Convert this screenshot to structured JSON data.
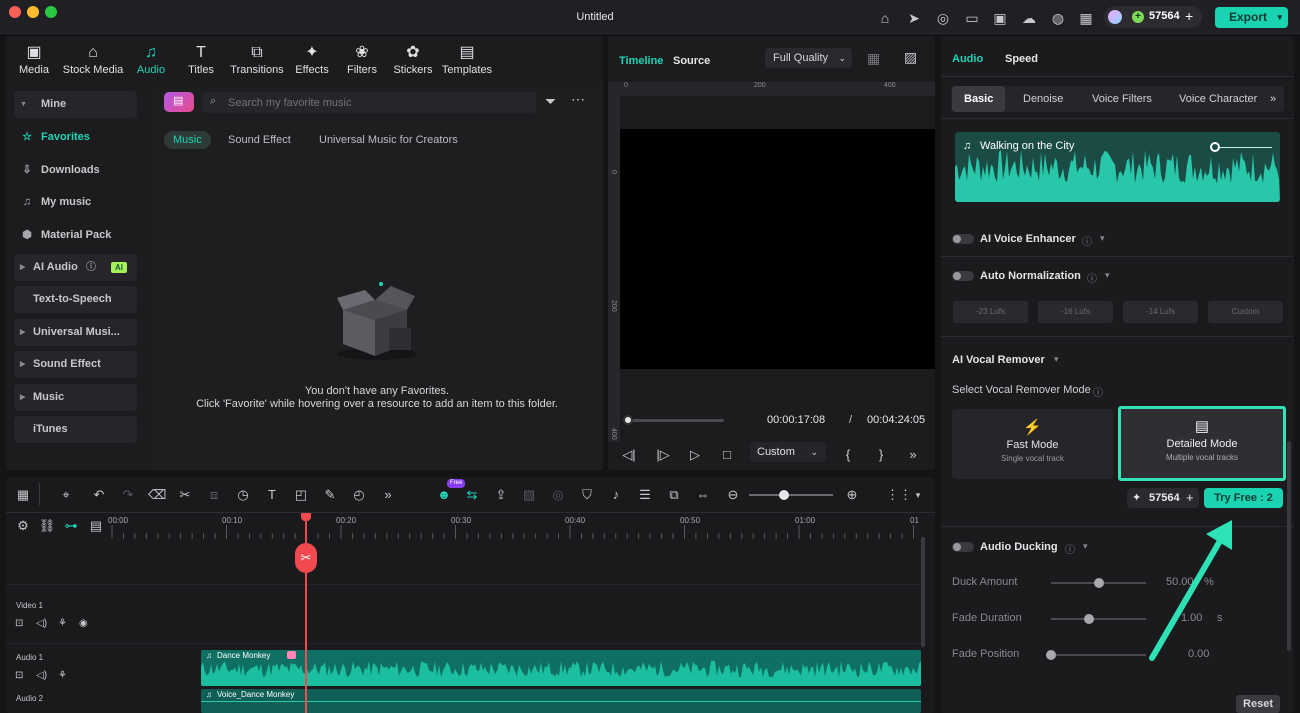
{
  "window": {
    "title": "Untitled"
  },
  "header": {
    "credits": "57564",
    "export_label": "Export"
  },
  "media_toolbar": {
    "items": [
      {
        "label": "Media",
        "icon": "media-icon"
      },
      {
        "label": "Stock Media",
        "icon": "stock-media-icon"
      },
      {
        "label": "Audio",
        "icon": "audio-icon"
      },
      {
        "label": "Titles",
        "icon": "titles-icon"
      },
      {
        "label": "Transitions",
        "icon": "transitions-icon"
      },
      {
        "label": "Effects",
        "icon": "effects-icon"
      },
      {
        "label": "Filters",
        "icon": "filters-icon"
      },
      {
        "label": "Stickers",
        "icon": "stickers-icon"
      },
      {
        "label": "Templates",
        "icon": "templates-icon"
      }
    ]
  },
  "sidebar": {
    "mine": "Mine",
    "favorites": "Favorites",
    "downloads": "Downloads",
    "my_music": "My music",
    "material_pack": "Material Pack",
    "ai_audio": "AI Audio",
    "ai_badge": "AI",
    "text_to_speech": "Text-to-Speech",
    "universal_music": "Universal Musi...",
    "sound_effect": "Sound Effect",
    "music": "Music",
    "itunes": "iTunes"
  },
  "media_content": {
    "search_placeholder": "Search my favorite music",
    "chips": [
      "Music",
      "Sound Effect",
      "Universal Music for Creators"
    ],
    "empty_line1": "You don't have any Favorites.",
    "empty_line2": "Click 'Favorite' while hovering over a resource to add an item to this folder."
  },
  "preview": {
    "tab_timeline": "Timeline",
    "tab_source": "Source",
    "quality": "Full Quality",
    "ruler_top": [
      "0",
      "200",
      "400"
    ],
    "ruler_left": [
      "0",
      "200",
      "400"
    ],
    "current_time": "00:00:17:08",
    "separator": "/",
    "total_time": "00:04:24:05",
    "zoom": "Custom",
    "progress": 0.04
  },
  "right_panel": {
    "tab_audio": "Audio",
    "tab_speed": "Speed",
    "subtabs": [
      "Basic",
      "Denoise",
      "Voice Filters",
      "Voice Character"
    ],
    "track_name": "Walking on the City",
    "ai_voice_enhancer": "AI Voice Enhancer",
    "auto_normalization": "Auto Normalization",
    "lufs": [
      "-23 Lufs",
      "-16 Lufs",
      "-14 Lufs",
      "Custom"
    ],
    "vocal_remover": "AI Vocal Remover",
    "select_mode": "Select Vocal Remover Mode",
    "fast_mode": "Fast Mode",
    "fast_mode_desc": "Single vocal track",
    "detailed_mode": "Detailed Mode",
    "detailed_mode_desc": "Multiple vocal tracks",
    "credits": "57564",
    "try_free": "Try Free : 2",
    "audio_ducking": "Audio Ducking",
    "duck_amount": "Duck Amount",
    "duck_amount_value": "50.00",
    "duck_amount_unit": "%",
    "duck_amount_level": 0.5,
    "fade_duration": "Fade Duration",
    "fade_duration_value": "1.00",
    "fade_duration_unit": "s",
    "fade_duration_level": 0.4,
    "fade_position": "Fade Position",
    "fade_position_value": "0.00",
    "fade_position_level": 0.0,
    "reset": "Reset"
  },
  "timeline": {
    "new_badge": "Free",
    "ruler": [
      "00:00",
      "00:10",
      "00:20",
      "00:30",
      "00:40",
      "00:50",
      "01:00",
      "01"
    ],
    "tracks": [
      {
        "name": "Video 1"
      },
      {
        "name": "Audio 1",
        "clip": "Dance Monkey"
      },
      {
        "name": "Audio 2",
        "clip": "Voice_Dance Monkey"
      }
    ]
  },
  "colors": {
    "accent": "#1ed5b6",
    "playhead": "#f04a50",
    "arrow": "#2de2b6"
  }
}
